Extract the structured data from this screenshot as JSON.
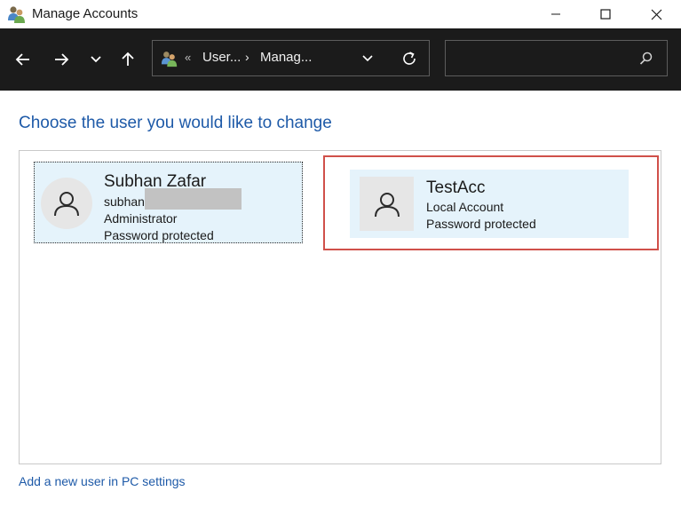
{
  "window": {
    "title": "Manage Accounts",
    "controls": [
      "minimize",
      "maximize",
      "close"
    ]
  },
  "navbar": {
    "address": {
      "overflow": "«",
      "segments": [
        "User...",
        "Manag..."
      ],
      "separator": "›"
    },
    "search": {
      "placeholder": ""
    }
  },
  "main": {
    "heading": "Choose the user you would like to change",
    "users": [
      {
        "name": "Subhan Zafar",
        "email": "subhan",
        "role": "Administrator",
        "status": "Password protected",
        "email_redacted": true
      },
      {
        "name": "TestAcc",
        "role": "Local Account",
        "status": "Password protected",
        "highlighted": true
      }
    ],
    "add_user_link": "Add a new user in PC settings"
  },
  "colors": {
    "titlebar_bg": "#ffffff",
    "navbar_bg": "#1b1b1b",
    "heading": "#1e5aa8",
    "tile_bg": "#e5f3fb",
    "highlight_border": "#d0504a"
  }
}
